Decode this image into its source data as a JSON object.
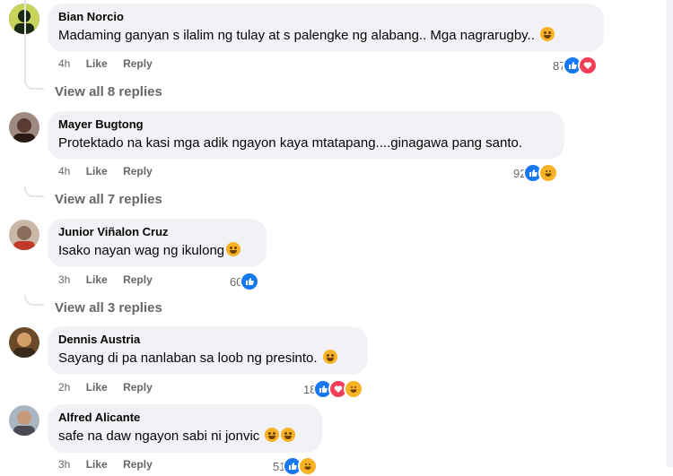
{
  "comments": [
    {
      "author": "Bian Norcio",
      "text": "Madaming ganyan s ilalim ng tulay at s palengke ng alabang.. Mga nagrarugby..",
      "emoji": "smile-emoji",
      "time": "4h",
      "like": "Like",
      "reply": "Reply",
      "count": "87",
      "reactions": [
        "like",
        "love"
      ],
      "view_replies": "View all 8 replies",
      "avatar_color": "#3e5a1f"
    },
    {
      "author": "Mayer Bugtong",
      "text": "Protektado na kasi mga adik ngayon kaya mtatapang....ginagawa pang santo.",
      "emoji": "",
      "time": "4h",
      "like": "Like",
      "reply": "Reply",
      "count": "92",
      "reactions": [
        "like",
        "haha"
      ],
      "view_replies": "View all 7 replies",
      "avatar_color": "#5a3b32"
    },
    {
      "author": "Junior Viñalon Cruz",
      "text": "Isako nayan wag ng ikulong",
      "emoji": "haha-emoji",
      "time": "3h",
      "like": "Like",
      "reply": "Reply",
      "count": "60",
      "reactions": [
        "like"
      ],
      "view_replies": "View all 3 replies",
      "avatar_color": "#8a6d5a"
    },
    {
      "author": "Dennis Austria",
      "text": "Sayang di pa nanlaban sa loob ng presinto.",
      "emoji": "grin-emoji",
      "time": "2h",
      "like": "Like",
      "reply": "Reply",
      "count": "18",
      "reactions": [
        "like",
        "love",
        "haha"
      ],
      "view_replies": "",
      "avatar_color": "#3a2a1c"
    },
    {
      "author": "Alfred Alicante",
      "text": "safe na daw ngayon sabi ni jonvic",
      "emoji": "haha-emoji-x2",
      "time": "3h",
      "like": "Like",
      "reply": "Reply",
      "count": "51",
      "reactions": [
        "like",
        "haha"
      ],
      "view_replies": "",
      "avatar_color": "#7a6a62"
    }
  ]
}
